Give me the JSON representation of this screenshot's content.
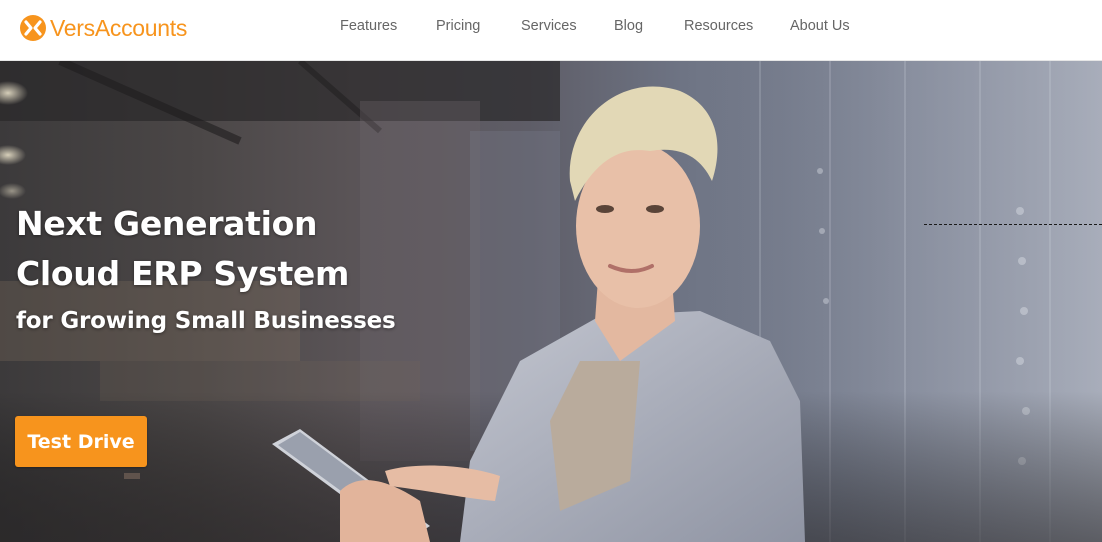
{
  "brand": {
    "name": "VersAccounts",
    "accent_color": "#f7941d"
  },
  "nav": {
    "items": [
      {
        "label": "Features"
      },
      {
        "label": "Pricing"
      },
      {
        "label": "Services"
      },
      {
        "label": "Blog"
      },
      {
        "label": "Resources"
      },
      {
        "label": "About Us"
      }
    ]
  },
  "hero": {
    "title_line1": "Next Generation",
    "title_line2": "Cloud ERP System",
    "subtitle": "for Growing Small Businesses",
    "cta_label": "Test Drive",
    "image_description_icon": "hero-photo"
  }
}
